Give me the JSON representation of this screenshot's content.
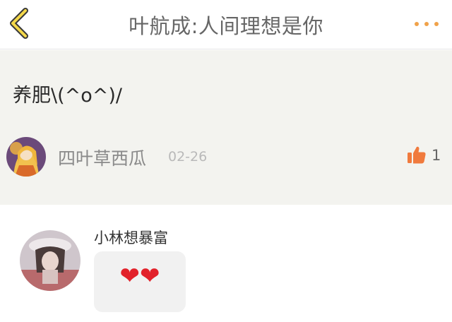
{
  "header": {
    "title": "叶航成:人间理想是你",
    "back_icon": "chevron-left-icon",
    "more_icon": "more-dots-icon",
    "accent_color": "#f0a24a"
  },
  "post": {
    "text": "养肥\\(^o^)/",
    "author": "四叶草西瓜",
    "date": "02-26",
    "like_icon": "thumbs-up-icon",
    "like_count": "1",
    "like_color": "#f07a3d"
  },
  "comment": {
    "author": "小林想暴富",
    "content": [
      "❤",
      "❤"
    ],
    "heart_color": "#e2212a"
  }
}
